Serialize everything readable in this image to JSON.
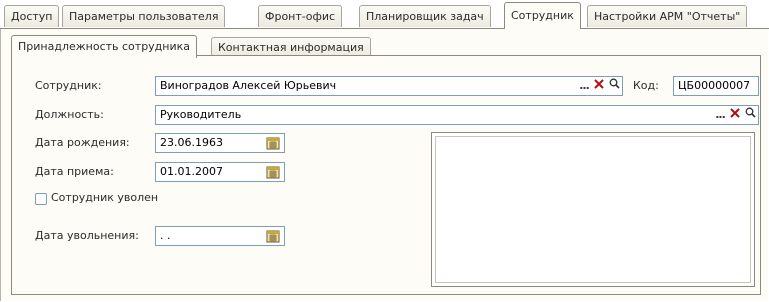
{
  "top_tabs": [
    "Доступ",
    "Параметры пользователя",
    "Фронт-офис",
    "Планировщик задач",
    "Сотрудник",
    "Настройки АРМ \"Отчеты\""
  ],
  "active_top_tab": "Сотрудник",
  "inner_tabs": [
    "Принадлежность сотрудника",
    "Контактная информация"
  ],
  "active_inner_tab": "Принадлежность сотрудника",
  "form": {
    "employee_label": "Сотрудник:",
    "employee_value": "Виноградов Алексей Юрьевич",
    "code_label": "Код:",
    "code_value": "ЦБ00000007",
    "position_label": "Должность:",
    "position_value": "Руководитель",
    "birth_label": "Дата рождения:",
    "birth_value": "23.06.1963",
    "hire_label": "Дата приема:",
    "hire_value": "01.01.2007",
    "fired_label": "Сотрудник уволен",
    "fired_checked": false,
    "dismissal_label": "Дата увольнения:",
    "dismissal_value": " .  ."
  },
  "buttons": {
    "select": "...",
    "clear": "×",
    "search": "search-icon"
  },
  "icons": [
    "ellipsis-icon",
    "clear-icon",
    "magnifier-icon",
    "calendar-icon"
  ],
  "colors": {
    "panel_bg": "#fdfcf7",
    "field_border": "#7f9db9",
    "clear_red": "#b01010"
  }
}
